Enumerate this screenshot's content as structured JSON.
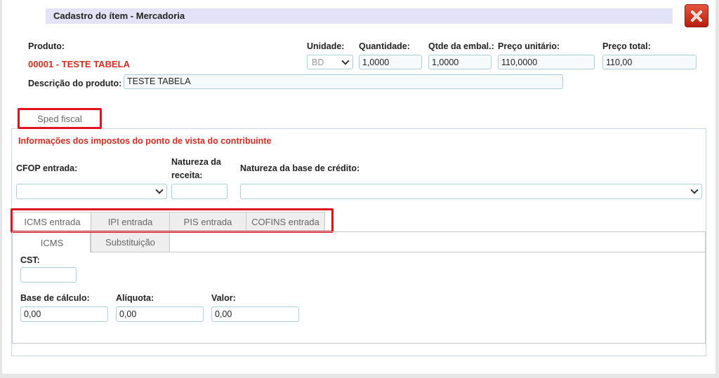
{
  "window": {
    "title": "Cadastro do ítem - Mercadoria"
  },
  "product": {
    "label": "Produto:",
    "value": "00001 - TESTE TABELA",
    "description_label": "Descrição do produto:",
    "description_value": "TESTE TABELA"
  },
  "fields": {
    "unidade_label": "Unidade:",
    "unidade_value": "BD",
    "quantidade_label": "Quantidade:",
    "quantidade_value": "1,0000",
    "qtde_embal_label": "Qtde da embal.:",
    "qtde_embal_value": "1,0000",
    "preco_unitario_label": "Preço unitário:",
    "preco_unitario_value": "110,0000",
    "preco_total_label": "Preço total:",
    "preco_total_value": "110,00"
  },
  "main_tabs": [
    {
      "label": "Sped fiscal"
    }
  ],
  "sped": {
    "info": "Informações dos impostos do ponto de vista do contribuinte",
    "cfop_label": "CFOP entrada:",
    "natureza_receita_label_1": "Natureza da",
    "natureza_receita_label_2": "receita:",
    "natureza_base_label": "Natureza da base de crédito:"
  },
  "tax_tabs": [
    {
      "label": "ICMS entrada"
    },
    {
      "label": "IPI entrada"
    },
    {
      "label": "PIS entrada"
    },
    {
      "label": "COFINS entrada"
    }
  ],
  "icms_tabs": [
    {
      "label": "ICMS"
    },
    {
      "label": "Substituição"
    }
  ],
  "icms": {
    "cst_label": "CST:",
    "cst_value": "",
    "base_label": "Base de cálculo:",
    "base_value": "0,00",
    "aliquota_label": "Alíquota:",
    "aliquota_value": "0,00",
    "valor_label": "Valor:",
    "valor_value": "0,00"
  },
  "colors": {
    "accent_red": "#d62b1f",
    "highlight": "#e0121f",
    "titlebar": "#e3e3f7"
  }
}
